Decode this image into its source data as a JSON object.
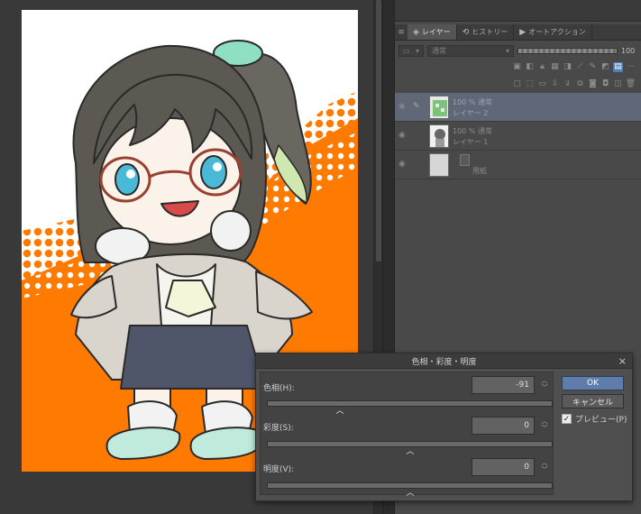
{
  "panel": {
    "menu_icon": "≡",
    "tabs": [
      {
        "icon": "layers-icon",
        "label": "レイヤー"
      },
      {
        "icon": "history-icon",
        "label": "ヒストリー"
      },
      {
        "icon": "auto-action-icon",
        "label": "オートアクション"
      }
    ],
    "blend_mode": "通常",
    "opacity": "100",
    "layers": [
      {
        "mode": "100 % 通常",
        "name": "レイヤー 2",
        "selected": true
      },
      {
        "mode": "100 % 通常",
        "name": "レイヤー 1",
        "selected": false
      },
      {
        "mode": "",
        "name": "用紙",
        "selected": false
      }
    ]
  },
  "dialog": {
    "title": "色相・彩度・明度",
    "close": "×",
    "hue": {
      "label": "色相(H):",
      "value": "-91",
      "fraction": 0.254
    },
    "saturation": {
      "label": "彩度(S):",
      "value": "0",
      "fraction": 0.5
    },
    "luminosity": {
      "label": "明度(V):",
      "value": "0",
      "fraction": 0.5
    },
    "ok": "OK",
    "cancel": "キャンセル",
    "preview": "プレビュー(P)",
    "preview_checked": true
  },
  "colors": {
    "accent": "#5e7dab",
    "art_orange": "#ff7a00",
    "selected_layer": "#606878"
  }
}
